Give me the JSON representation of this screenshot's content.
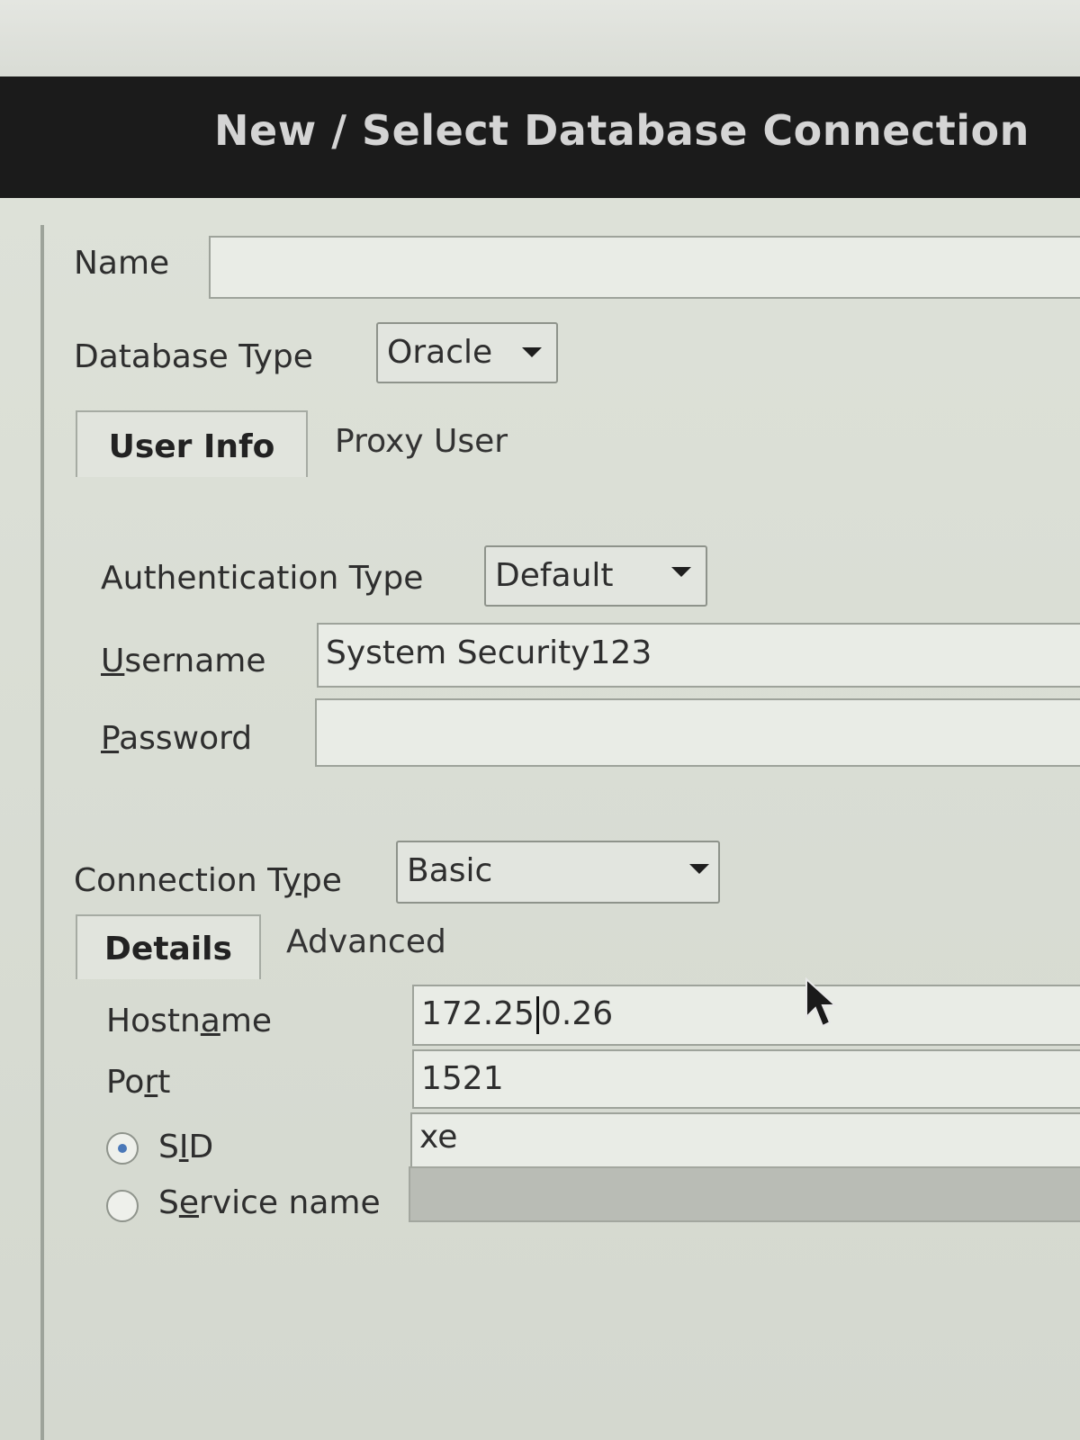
{
  "dialog": {
    "title": "New / Select Database Connection"
  },
  "form": {
    "name": {
      "label": "Name",
      "value": ""
    },
    "database_type": {
      "label": "Database Type",
      "value": "Oracle"
    },
    "user_tabs": [
      {
        "label": "User Info",
        "active": true
      },
      {
        "label": "Proxy User",
        "active": false
      }
    ],
    "auth_type": {
      "label": "Authentication Type",
      "value": "Default"
    },
    "username": {
      "label_prefix": "",
      "label_mnemonic": "U",
      "label_rest": "sername",
      "value": "System Security123"
    },
    "password": {
      "label_mnemonic": "P",
      "label_rest": "assword",
      "value": ""
    },
    "connection_type": {
      "label_a": "Connection T",
      "label_mnemonic": "y",
      "label_b": "pe",
      "value": "Basic"
    },
    "detail_tabs": [
      {
        "label": "Details",
        "active": true
      },
      {
        "label": "Advanced",
        "active": false
      }
    ],
    "hostname": {
      "label_a": "Hostn",
      "label_mnemonic": "a",
      "label_b": "me",
      "value_a": "172.25",
      "value_b": "0.26"
    },
    "port": {
      "label_a": "Po",
      "label_mnemonic": "r",
      "label_b": "t",
      "value": "1521"
    },
    "sid": {
      "label_a": "S",
      "label_mnemonic": "I",
      "label_b": "D",
      "value": "xe",
      "selected": true
    },
    "service_name": {
      "label_a": "S",
      "label_mnemonic": "e",
      "label_b": "rvice name",
      "value": "",
      "selected": false
    }
  },
  "icons": {
    "dropdown": "triangle-down",
    "cursor": "mouse-pointer"
  }
}
